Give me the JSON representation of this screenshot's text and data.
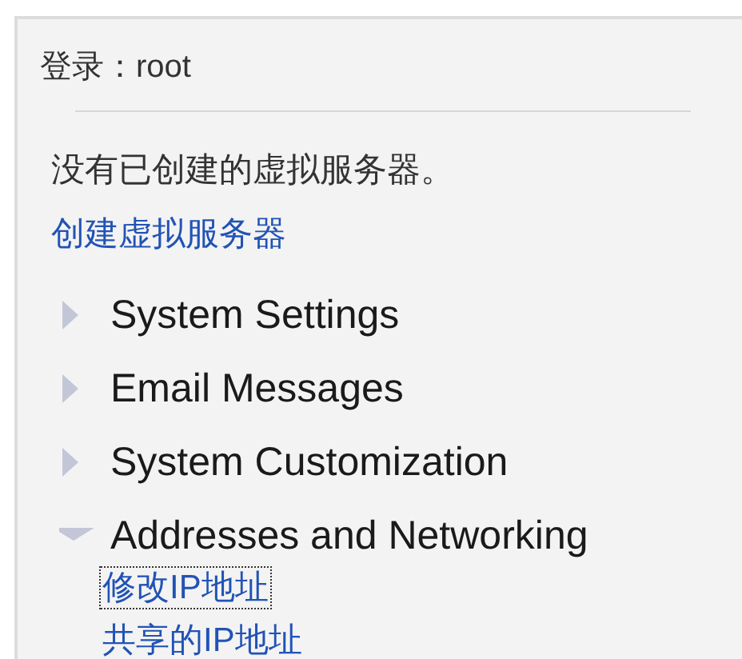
{
  "login": "登录：root",
  "message": "没有已创建的虚拟服务器。",
  "create_link": "创建虚拟服务器",
  "tree": [
    {
      "label": "System Settings",
      "expanded": false
    },
    {
      "label": "Email Messages",
      "expanded": false
    },
    {
      "label": "System Customization",
      "expanded": false
    },
    {
      "label": "Addresses and Networking",
      "expanded": true,
      "children": [
        {
          "label": "修改IP地址",
          "focused": true
        },
        {
          "label": "共享的IP地址",
          "focused": false
        }
      ]
    }
  ]
}
